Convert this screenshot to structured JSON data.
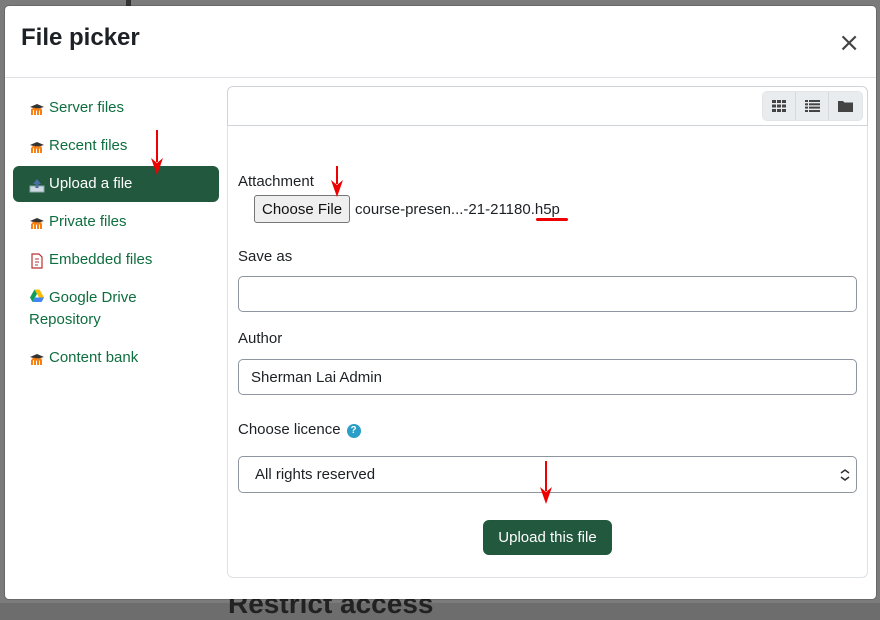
{
  "dialog": {
    "title": "File picker",
    "close_symbol": "×"
  },
  "background": {
    "heading_fragment": "Restrict access"
  },
  "sidebar": {
    "items": [
      {
        "label": "Server files",
        "icon": "moodle-icon",
        "active": false
      },
      {
        "label": "Recent files",
        "icon": "moodle-icon",
        "active": false
      },
      {
        "label": "Upload a file",
        "icon": "upload-icon",
        "active": true
      },
      {
        "label": "Private files",
        "icon": "moodle-icon",
        "active": false
      },
      {
        "label": "Embedded files",
        "icon": "document-icon",
        "active": false
      },
      {
        "label": "Google Drive Repository",
        "icon": "google-drive-icon",
        "active": false
      },
      {
        "label": "Content bank",
        "icon": "moodle-icon",
        "active": false
      }
    ]
  },
  "toolbar": {
    "views": [
      "grid-view-icon",
      "list-view-icon",
      "folder-view-icon"
    ]
  },
  "form": {
    "attachment_label": "Attachment",
    "choose_file_label": "Choose File",
    "file_name": "course-presen...-21-21180.h5p",
    "save_as_label": "Save as",
    "save_as_value": "",
    "author_label": "Author",
    "author_value": "Sherman Lai Admin",
    "licence_label": "Choose licence",
    "licence_value": "All rights reserved",
    "upload_label": "Upload this file"
  },
  "colors": {
    "brand_green": "#22583d",
    "link_green": "#0f6e3f",
    "annotation_red": "#e00000",
    "help_blue": "#2a9ec6"
  }
}
